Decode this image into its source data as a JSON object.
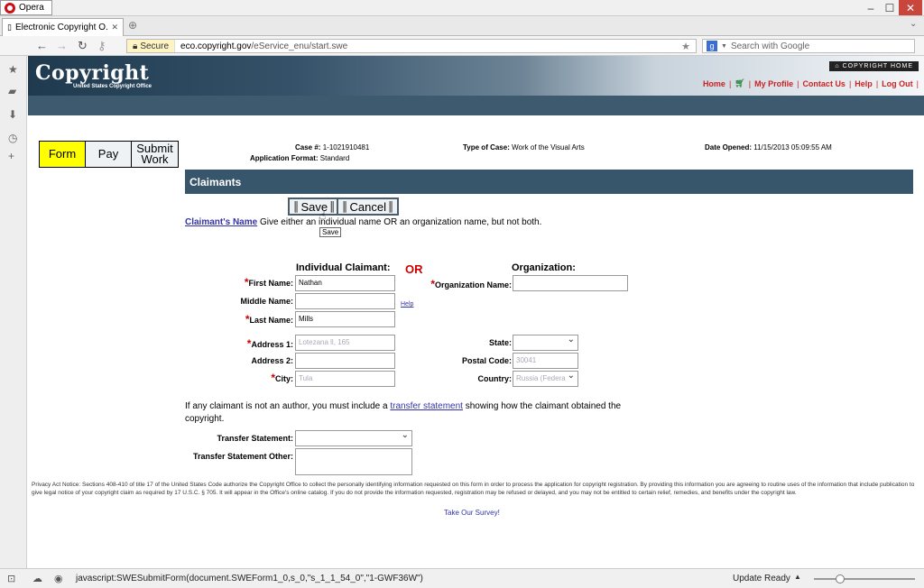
{
  "browser": {
    "app_name": "Opera",
    "tab_title": "Electronic Copyright O...",
    "secure_label": "Secure",
    "url_host": "eco.copyright.gov",
    "url_path": "/eService_enu/start.swe",
    "search_placeholder": "Search with Google",
    "status_text": "javascript:SWESubmitForm(document.SWEForm1_0,s_0,\"s_1_1_54_0\",\"1-GWF36W\")",
    "status_right": "Update Ready"
  },
  "site": {
    "logo": "Copyright",
    "logo_sub": "United States Copyright Office",
    "home_badge": "COPYRIGHT HOME",
    "links": [
      "Home",
      "My Profile",
      "Contact Us",
      "Help",
      "Log Out"
    ]
  },
  "steps": [
    "Form",
    "Pay",
    "Submit Work"
  ],
  "case": {
    "case_label": "Case #:",
    "case_value": "1-1021910481",
    "format_label": "Application Format:",
    "format_value": "Standard",
    "type_label": "Type of Case:",
    "type_value": "Work of the Visual Arts",
    "date_label": "Date Opened:",
    "date_value": "11/15/2013 05:09:55 AM"
  },
  "section_title": "Claimants",
  "actions": {
    "save": "Save",
    "cancel": "Cancel",
    "tooltip": "Save"
  },
  "claimant_name_link": "Claimant's Name",
  "claimant_name_hint": "Give either an individual name OR an organization name, but not both.",
  "individual_heading": "Individual Claimant:",
  "or_label": "OR",
  "organization_heading": "Organization:",
  "fields": {
    "first_name_label": "First Name:",
    "first_name_value": "Nathan",
    "middle_name_label": "Middle Name:",
    "middle_name_value": "",
    "last_name_label": "Last Name:",
    "last_name_value": "Mills",
    "org_name_label": "Organization Name:",
    "org_name_value": "",
    "help_link": "Help",
    "address1_label": "Address 1:",
    "address1_value": "Lotezana ll, 165",
    "address2_label": "Address 2:",
    "address2_value": "",
    "city_label": "City:",
    "city_value": "Tula",
    "state_label": "State:",
    "state_value": "",
    "postal_label": "Postal Code:",
    "postal_value": "30041",
    "country_label": "Country:",
    "country_value": "Russia (Federa"
  },
  "transfer": {
    "text_before": "If any claimant is not an author, you must include a",
    "link": "transfer statement",
    "text_after": "showing how the claimant obtained the copyright.",
    "statement_label": "Transfer Statement:",
    "statement_other_label": "Transfer Statement Other:"
  },
  "privacy_notice": "Privacy Act Notice: Sections 408-410 of title 17 of the United States Code authorize the Copyright Office to collect the personally identifying information requested on this form in order to process the application for copyright registration. By providing this information you are agreeing to routine uses of the information that include publication to give legal notice of your copyright claim as required by 17 U.S.C. § 705. It will appear in the Office's online catalog. If you do not provide the information requested, registration may be refused or delayed, and you may not be entitled to certain relief, remedies, and benefits under the copyright law.",
  "survey_link": "Take Our Survey!"
}
